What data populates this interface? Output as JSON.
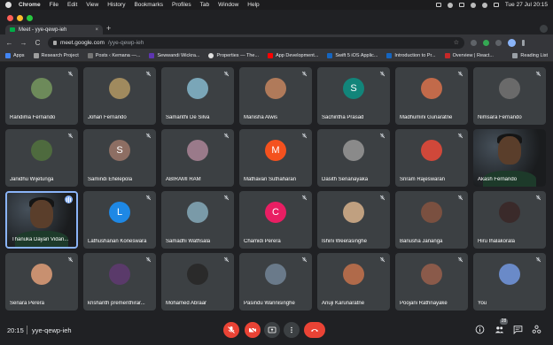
{
  "menubar": {
    "app_name": "Chrome",
    "menus": [
      "File",
      "Edit",
      "View",
      "History",
      "Bookmarks",
      "Profiles",
      "Tab",
      "Window",
      "Help"
    ],
    "clock": "Tue 27 Jul  20:15"
  },
  "browser": {
    "tab_title": "Meet - yye-qewp-ieh",
    "tab_close": "×",
    "new_tab": "+",
    "url_host": "meet.google.com",
    "url_path": "/yye-qewp-ieh",
    "back": "←",
    "forward": "→",
    "reload": "C",
    "star": "☆"
  },
  "bookmarks": {
    "items": [
      {
        "label": "Apps",
        "color": "#4285f4"
      },
      {
        "label": "Research Project",
        "color": "#9e9e9e"
      },
      {
        "label": "Posts ‹ Kemana —...",
        "color": "#757575"
      },
      {
        "label": "Sewwandi Wickra...",
        "color": "#5e35b1"
      },
      {
        "label": "Properties — The...",
        "color": "#e0e0e0"
      },
      {
        "label": "App Development...",
        "color": "#ff0000"
      },
      {
        "label": "Swift 5 iOS Applic...",
        "color": "#1565c0"
      },
      {
        "label": "Introduction to Pr...",
        "color": "#1565c0"
      },
      {
        "label": "Overview | React...",
        "color": "#c62828"
      }
    ],
    "reading_list": "Reading List"
  },
  "participants": [
    {
      "name": "Randima Fernando",
      "kind": "photo",
      "color": "#6d8a5a",
      "muted": true
    },
    {
      "name": "Johan Fernando",
      "kind": "photo",
      "color": "#a08a5e",
      "muted": true
    },
    {
      "name": "Samanthi De Silva",
      "kind": "photo",
      "color": "#7aa6b8",
      "muted": true
    },
    {
      "name": "Manisha Alwis",
      "kind": "photo",
      "color": "#b07a5a",
      "muted": true
    },
    {
      "name": "Sachintha Prasad",
      "kind": "letter",
      "initial": "S",
      "color": "#12857a",
      "muted": true
    },
    {
      "name": "Madhumini Gunaratne",
      "kind": "photo",
      "color": "#c26a4a",
      "muted": true
    },
    {
      "name": "Nimsara Fernando",
      "kind": "photo",
      "color": "#6a6a6a",
      "muted": true
    },
    {
      "name": "Janidhu Wijetunga",
      "kind": "photo",
      "color": "#4e6a3e",
      "muted": true
    },
    {
      "name": "Samindi Ehelepola",
      "kind": "letter",
      "initial": "S",
      "color": "#8d6e63",
      "muted": true
    },
    {
      "name": "ABIRAMI RAM",
      "kind": "photo",
      "color": "#9a7a8a",
      "muted": true
    },
    {
      "name": "Mathavan Suthaharan",
      "kind": "letter",
      "initial": "M",
      "color": "#f4511e",
      "muted": true
    },
    {
      "name": "Dasith Senanayaka",
      "kind": "photo",
      "color": "#8a8a8a",
      "muted": true
    },
    {
      "name": "Sriram Rajeswaran",
      "kind": "photo",
      "color": "#d0483a",
      "muted": true
    },
    {
      "name": "Akash Fernando",
      "kind": "video",
      "muted": false
    },
    {
      "name": "Thanuka Dayan Vidan...",
      "kind": "video",
      "muted": false,
      "active": true
    },
    {
      "name": "Lathushanan Koneswara",
      "kind": "letter",
      "initial": "L",
      "color": "#1e88e5",
      "muted": true
    },
    {
      "name": "Samadhi Wathsala",
      "kind": "photo",
      "color": "#7a9aa8",
      "muted": true
    },
    {
      "name": "Chamidi Perera",
      "kind": "letter",
      "initial": "C",
      "color": "#e91e63",
      "muted": true
    },
    {
      "name": "Ishini Weerasinghe",
      "kind": "photo",
      "color": "#c0a080",
      "muted": true
    },
    {
      "name": "Banusha Jananga",
      "kind": "photo",
      "color": "#7a5040",
      "muted": true
    },
    {
      "name": "Hiru Ihalakorala",
      "kind": "photo",
      "color": "#3a2a2a",
      "muted": true
    },
    {
      "name": "Senara Perera",
      "kind": "photo",
      "color": "#c89070",
      "muted": true
    },
    {
      "name": "krishanth prementhirar...",
      "kind": "photo",
      "color": "#5a3a6a",
      "muted": true
    },
    {
      "name": "Mohamed Abraar",
      "kind": "photo",
      "color": "#2a2a2a",
      "muted": true
    },
    {
      "name": "Pasindu Wannisinghe",
      "kind": "photo",
      "color": "#6a7a8a",
      "muted": true
    },
    {
      "name": "Anuji Karunaratne",
      "kind": "photo",
      "color": "#b06a4a",
      "muted": true
    },
    {
      "name": "Poojani Rathnayake",
      "kind": "photo",
      "color": "#8a5a4a",
      "muted": true
    },
    {
      "name": "You",
      "kind": "photo",
      "color": "#6a8ac8",
      "muted": true
    }
  ],
  "bottombar": {
    "time": "20:15",
    "meeting_code": "yye-qewp-ieh",
    "participant_count": "28"
  },
  "colors": {
    "accent": "#8ab4f8",
    "danger": "#ea4335",
    "tile": "#3c4043",
    "background": "#202124"
  }
}
